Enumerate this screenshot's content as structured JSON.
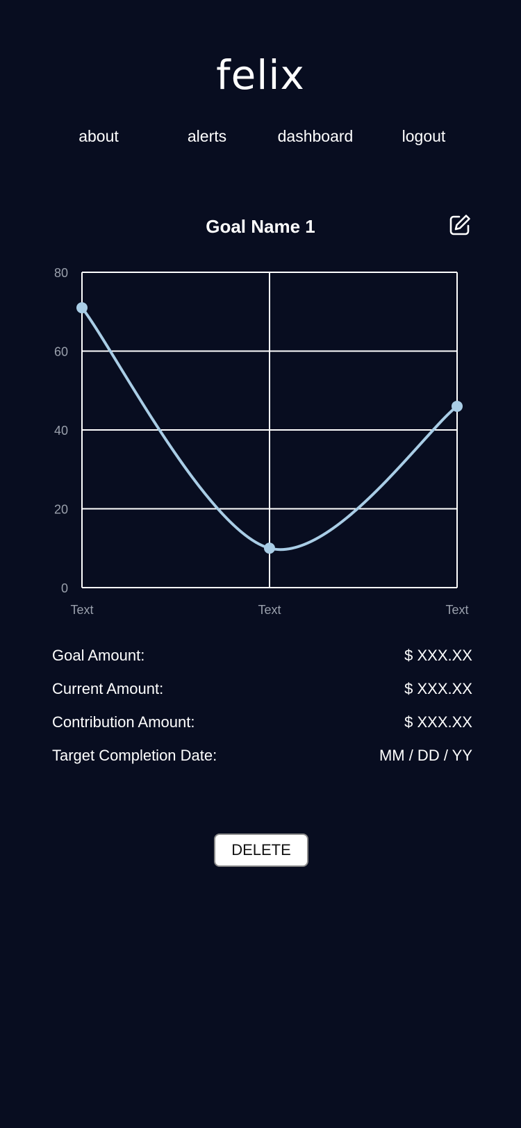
{
  "app": {
    "logo": "felix"
  },
  "nav": {
    "items": [
      {
        "label": "about"
      },
      {
        "label": "alerts"
      },
      {
        "label": "dashboard"
      },
      {
        "label": "logout"
      }
    ]
  },
  "goal": {
    "title": "Goal Name 1",
    "edit_icon": "edit-icon"
  },
  "chart_data": {
    "type": "line",
    "categories": [
      "Text",
      "Text",
      "Text"
    ],
    "values": [
      71,
      10,
      46
    ],
    "ylim": [
      0,
      80
    ],
    "yticks": [
      "0",
      "20",
      "40",
      "60",
      "80"
    ],
    "grid": true,
    "smooth": true,
    "line_color": "#a9cde6",
    "grid_color": "#ffffff",
    "tick_color": "#9aa0ac"
  },
  "details": {
    "rows": [
      {
        "label": "Goal Amount:",
        "value": "$ XXX.XX"
      },
      {
        "label": "Current Amount:",
        "value": "$ XXX.XX"
      },
      {
        "label": "Contribution Amount:",
        "value": "$ XXX.XX"
      },
      {
        "label": "Target Completion Date:",
        "value": "MM / DD / YY"
      }
    ]
  },
  "actions": {
    "delete_label": "DELETE"
  }
}
